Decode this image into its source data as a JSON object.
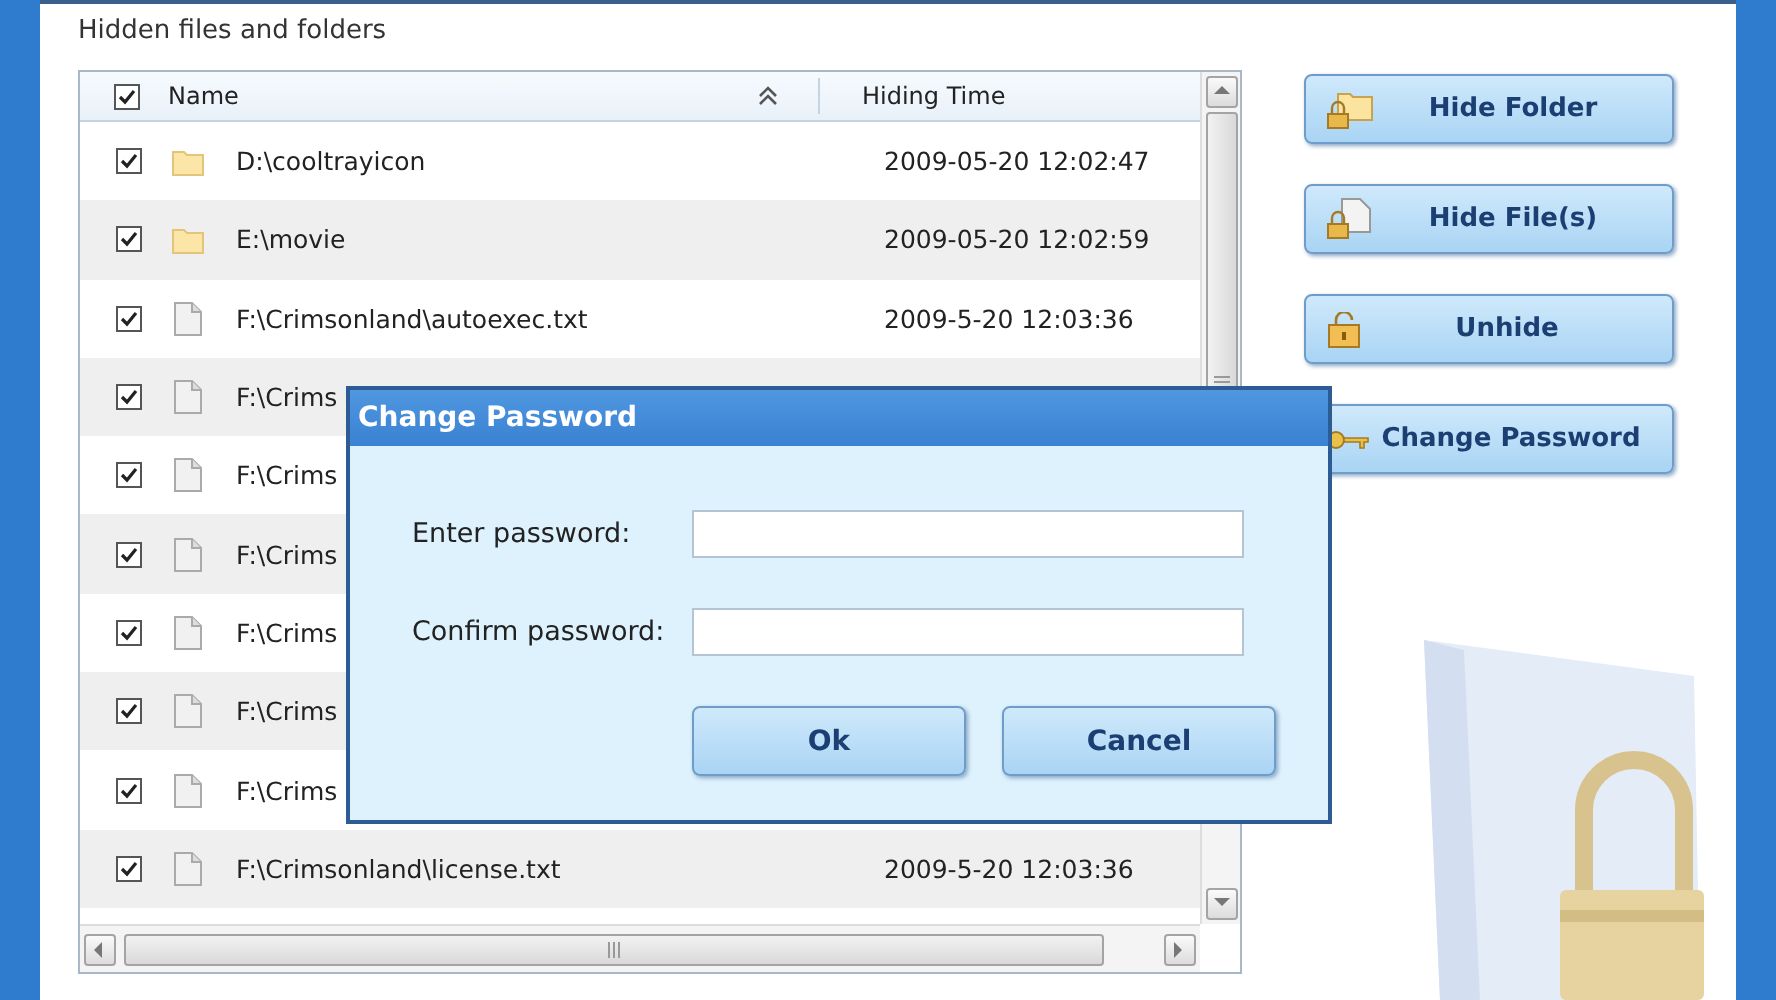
{
  "section_label": "Hidden files and folders",
  "table": {
    "select_all_checked": true,
    "columns": [
      {
        "label": "Name",
        "sorted": true
      },
      {
        "label": "Hiding Time"
      }
    ],
    "rows": [
      {
        "kind": "folder",
        "checked": true,
        "name": "D:\\cooltrayicon",
        "time": "2009-05-20 12:02:47"
      },
      {
        "kind": "folder",
        "checked": true,
        "name": "E:\\movie",
        "time": "2009-05-20 12:02:59"
      },
      {
        "kind": "file",
        "checked": true,
        "name": "F:\\Crimsonland\\autoexec.txt",
        "time": "2009-5-20 12:03:36"
      },
      {
        "kind": "file",
        "checked": true,
        "name": "F:\\Crims"
      },
      {
        "kind": "file",
        "checked": true,
        "name": "F:\\Crims"
      },
      {
        "kind": "file",
        "checked": true,
        "name": "F:\\Crims"
      },
      {
        "kind": "file",
        "checked": true,
        "name": "F:\\Crims"
      },
      {
        "kind": "file",
        "checked": true,
        "name": "F:\\Crims"
      },
      {
        "kind": "file",
        "checked": true,
        "name": "F:\\Crims"
      },
      {
        "kind": "file",
        "checked": true,
        "name": "F:\\Crimsonland\\license.txt",
        "time": "2009-5-20 12:03:36"
      }
    ]
  },
  "buttons": [
    {
      "label": "Hide Folder",
      "kind": "hide-folder"
    },
    {
      "label": "Hide File(s)",
      "kind": "hide-files"
    },
    {
      "label": "Unhide",
      "kind": "unhide"
    },
    {
      "label": "Change Password",
      "kind": "change-password"
    }
  ],
  "dialog": {
    "title": "Change Password",
    "fields": [
      {
        "label": "Enter password:"
      },
      {
        "label": "Confirm password:"
      }
    ],
    "buttons": [
      "Ok",
      "Cancel"
    ]
  }
}
